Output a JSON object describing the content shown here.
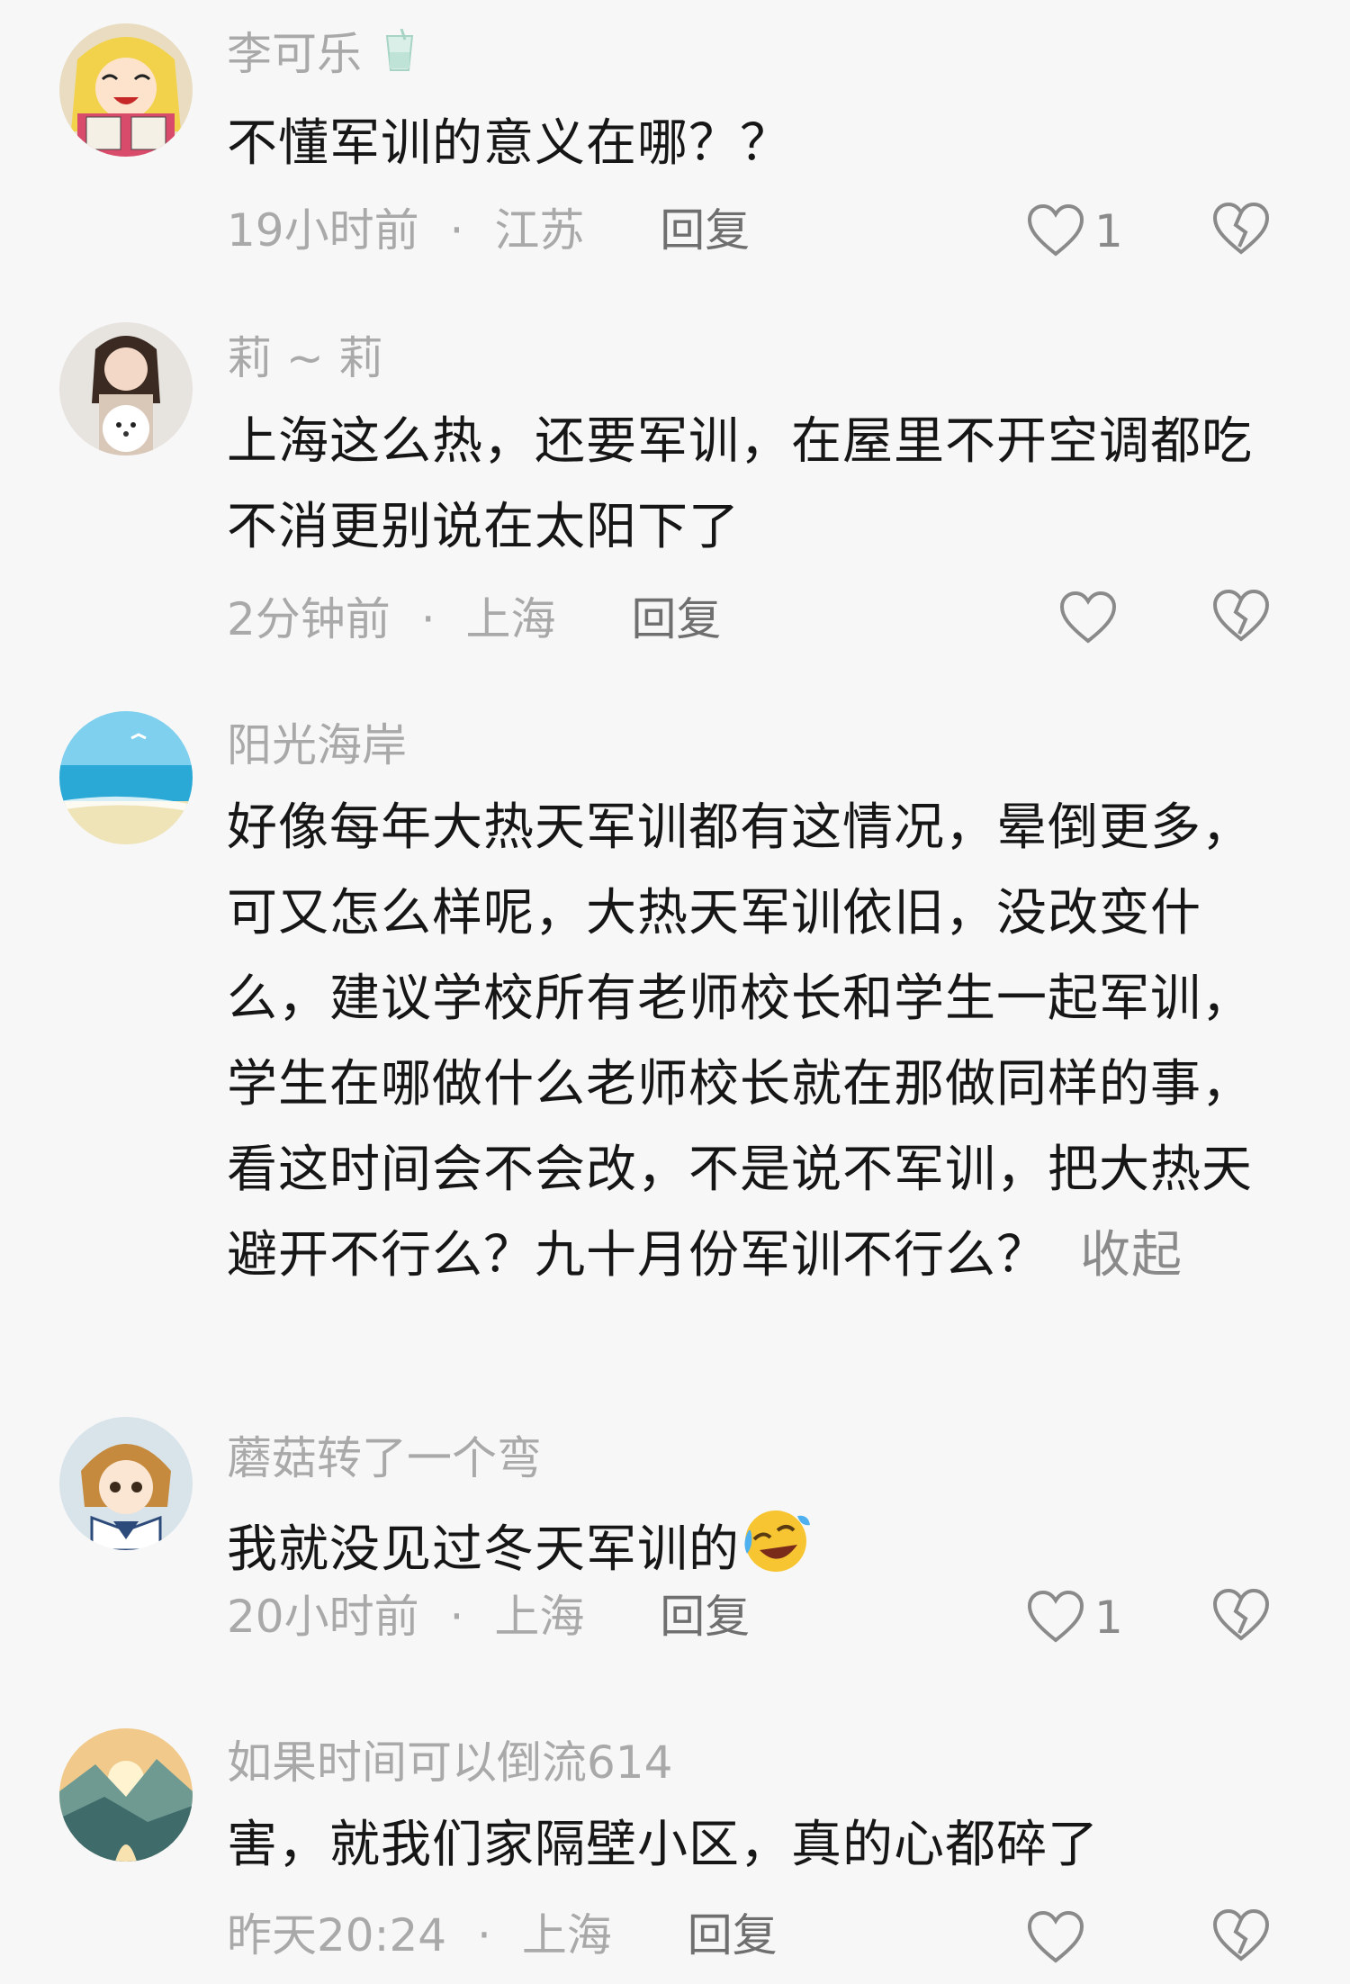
{
  "comments": [
    {
      "user": "李可乐",
      "text": "不懂军训的意义在哪？？",
      "time": "19小时前",
      "location": "江苏",
      "reply_label": "回复",
      "likes": "1",
      "avatar_icon": "anime-girl-avatar-icon"
    },
    {
      "user": "莉 ~ 莉",
      "text": "上海这么热，还要军训，在屋里不开空调都吃不消更别说在太阳下了",
      "time": "2分钟前",
      "location": "上海",
      "reply_label": "回复",
      "likes": "",
      "avatar_icon": "woman-with-dog-avatar-icon"
    },
    {
      "user": "阳光海岸",
      "text": "好像每年大热天军训都有这情况，晕倒更多，可又怎么样呢，大热天军训依旧，没改变什么，建议学校所有老师校长和学生一起军训，学生在哪做什么老师校长就在那做同样的事，看这时间会不会改，不是说不军训，把大热天避开不行么？九十月份军训不行么？",
      "collapse_label": "收起",
      "avatar_icon": "beach-avatar-icon"
    },
    {
      "user": "蘑菇转了一个弯",
      "text": "我就没见过冬天军训的",
      "time": "20小时前",
      "location": "上海",
      "reply_label": "回复",
      "likes": "1",
      "avatar_icon": "anime-girl-sailor-avatar-icon"
    },
    {
      "user": "如果时间可以倒流614",
      "text": "害，就我们家隔壁小区，真的心都碎了",
      "time": "昨天20:24",
      "location": "上海",
      "reply_label": "回复",
      "likes": "",
      "avatar_icon": "sunset-landscape-avatar-icon"
    }
  ],
  "meta_separator": "·",
  "colors": {
    "background": "#f7f7f7",
    "username": "#a9a9a9",
    "text": "#161616",
    "icon": "#8a8a8a"
  }
}
